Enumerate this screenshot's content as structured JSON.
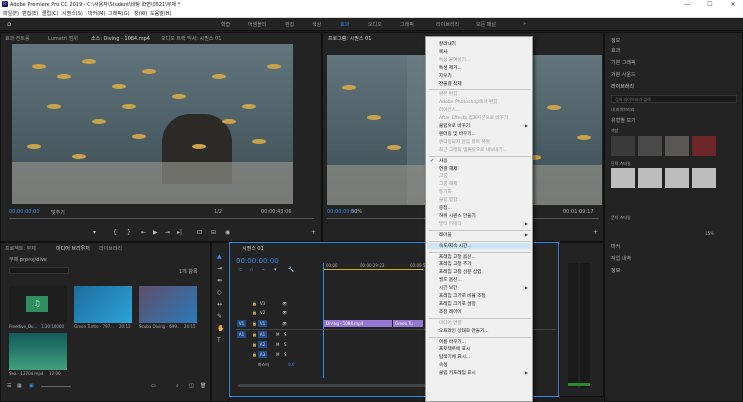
{
  "app": {
    "title": "Adobe Premiere Pro CC 2019 - C:\\사용자\\Student\\바탕 화면\\0521\\무제 *",
    "minimize": "—",
    "maximize": "☐",
    "close": "✕"
  },
  "menu": [
    "파일(F)",
    "편집(E)",
    "클립(C)",
    "시퀀스(S)",
    "마커(M)",
    "그래픽(G)",
    "창(W)",
    "도움말(H)"
  ],
  "workspaces": [
    "학습",
    "어셈블리",
    "편집",
    "색상",
    "효과",
    "오디오",
    "그래픽",
    "라이브러리",
    "모든 패널"
  ],
  "source_monitor": {
    "tabs": [
      "효과 컨트롤",
      "Lumetri 범위",
      "소스: Diving - 1084.mp4",
      "오디오 트랙 믹서: 시퀀스 01"
    ],
    "timecode": "00:00:00:00",
    "fit": "맞추기",
    "ratio": "1/2",
    "duration": "00:00:43:06"
  },
  "program_monitor": {
    "tab": "프로그램: 시퀀스 01",
    "timecode": "00:00:00:00",
    "zoom": "50%",
    "duration": "00:01:09:17"
  },
  "project": {
    "tabs": [
      "프로젝트: 무제",
      "미디어 브라우저",
      "라이브러리"
    ],
    "search_placeholder": "",
    "count": "1개 항목",
    "path": "무제.prproj/dive",
    "items": [
      {
        "name": "Freedive_Du...",
        "dur": "1:30:10000"
      },
      {
        "name": "Green Turtle - 797...",
        "dur": "20:13"
      },
      {
        "name": "Scuba Diving - 699...",
        "dur": "24:15"
      },
      {
        "name": "Sea - 12704.mp4",
        "dur": "12:00"
      }
    ]
  },
  "timeline": {
    "tab": "시퀀스 01",
    "timecode": "00:00:00:00",
    "ruler": [
      "00:00",
      "00:00:29:23",
      "00:00:59:22",
      "00:01:29:21"
    ],
    "tracks_v": [
      "V3",
      "V2",
      "V1"
    ],
    "tracks_a": [
      "A1",
      "A2",
      "A3"
    ],
    "master": "마스터",
    "master_val": "0.0",
    "clips": [
      {
        "label": "Diving - 1084.mp4"
      },
      {
        "label": "Green Tu"
      }
    ],
    "src_v": "V1",
    "src_a": "A1"
  },
  "context_menu": {
    "items": [
      {
        "label": "잘라내기",
        "dis": false
      },
      {
        "label": "복사",
        "dis": false
      },
      {
        "label": "특성 붙여넣기...",
        "dis": true
      },
      {
        "label": "특성 제거...",
        "dis": false
      },
      {
        "label": "지우기",
        "dis": false
      },
      {
        "label": "잔물결 삭제",
        "dis": false
      },
      {
        "label": "원본 편집",
        "dis": true
      },
      {
        "label": "Adobe Photoshop에서 편집",
        "dis": true
      },
      {
        "label": "라이선스...",
        "dis": true
      },
      {
        "label": "After Effects 컴포지션으로 바꾸기",
        "dis": true
      },
      {
        "label": "클립으로 바꾸기",
        "dis": false,
        "sub": true
      },
      {
        "label": "렌더링 및 바꾸기...",
        "dis": false
      },
      {
        "label": "렌더링되지 않음 항목 복원",
        "dis": true
      },
      {
        "label": "최근 그래픽 템플릿으로 내보내기...",
        "dis": true
      },
      {
        "label": "사용",
        "dis": false,
        "check": true
      },
      {
        "label": "연결 해제",
        "dis": false
      },
      {
        "label": "그룹",
        "dis": true
      },
      {
        "label": "그룹 해제",
        "dis": true
      },
      {
        "label": "동기화",
        "dis": true
      },
      {
        "label": "클립 병합...",
        "dis": true
      },
      {
        "label": "중첩...",
        "dis": false
      },
      {
        "label": "하위 시퀀스 만들기",
        "dis": false
      },
      {
        "label": "멀티 카메라",
        "dis": true,
        "sub": true
      },
      {
        "label": "레이블",
        "dis": false,
        "sub": true
      },
      {
        "label": "속도/지속 시간...",
        "dis": false,
        "hl": true
      },
      {
        "label": "프레임 고정 옵션...",
        "dis": false
      },
      {
        "label": "프레임 고정 추가",
        "dis": false
      },
      {
        "label": "프레임 고정 선분 삽입",
        "dis": false
      },
      {
        "label": "필드 옵션...",
        "dis": false
      },
      {
        "label": "시간 보간",
        "dis": false,
        "sub": true
      },
      {
        "label": "프레임 크기로 비율 조정",
        "dis": false
      },
      {
        "label": "프레임 크기로 설정",
        "dis": false
      },
      {
        "label": "조정 레이어",
        "dis": false
      },
      {
        "label": "미디어 연결",
        "dis": true
      },
      {
        "label": "오프라인 상태로 만들기...",
        "dis": false
      },
      {
        "label": "이름 바꾸기...",
        "dis": false
      },
      {
        "label": "프로젝트에 표시",
        "dis": false
      },
      {
        "label": "탐색기에 표시...",
        "dis": false
      },
      {
        "label": "속성",
        "dis": false
      },
      {
        "label": "클립 키프레임 표시",
        "dis": false,
        "sub": true
      }
    ]
  },
  "right_panel": {
    "items": [
      "정보",
      "효과",
      "기본 그래픽",
      "기본 사운드",
      "Lumetri 색상",
      "라이브러리"
    ],
    "search_placeholder": "검색 라이브러리 검색",
    "library_name": "내 라이브러리",
    "view": "유형별 보기",
    "colors_label": "색상",
    "char_styles": "단락 스타일",
    "char_styles2": "문자 스타일",
    "zoom": "15%",
    "bottom_items": [
      "마커",
      "작업 내역",
      "정보"
    ],
    "colors": [
      "#3a3a3a",
      "#4a4a4a",
      "#5b5656",
      "#6a2628"
    ]
  }
}
